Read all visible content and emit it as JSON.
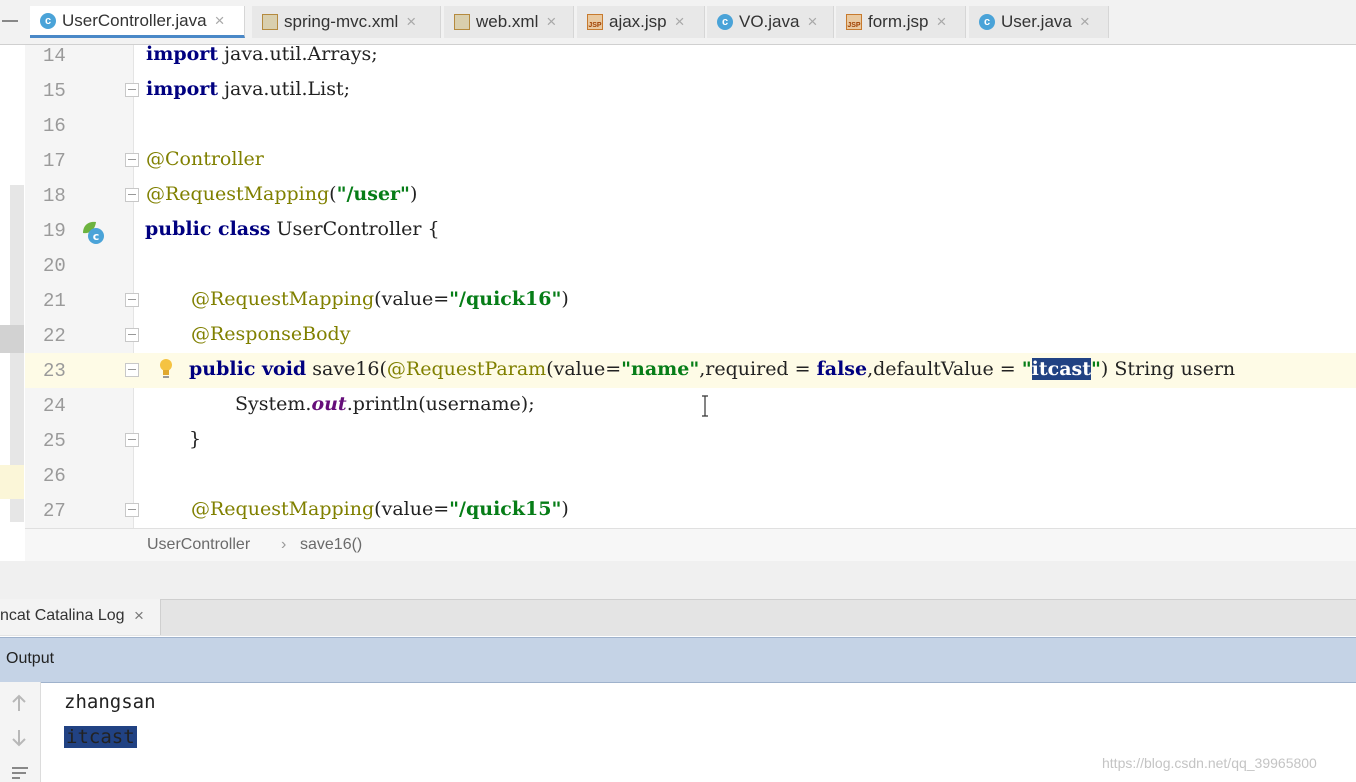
{
  "tabs": [
    {
      "label": "UserController.java",
      "icon": "java-class-icon",
      "active": true
    },
    {
      "label": "spring-mvc.xml",
      "icon": "spring-xml-icon",
      "active": false
    },
    {
      "label": "web.xml",
      "icon": "xml-file-icon",
      "active": false
    },
    {
      "label": "ajax.jsp",
      "icon": "jsp-file-icon",
      "active": false
    },
    {
      "label": "VO.java",
      "icon": "java-class-icon",
      "active": false
    },
    {
      "label": "form.jsp",
      "icon": "jsp-file-icon",
      "active": false
    },
    {
      "label": "User.java",
      "icon": "java-class-icon",
      "active": false
    }
  ],
  "editor": {
    "line_numbers": [
      "14",
      "15",
      "16",
      "17",
      "18",
      "19",
      "20",
      "21",
      "22",
      "23",
      "24",
      "25",
      "26",
      "27"
    ],
    "code": {
      "l14_kw": "import",
      "l14_rest": " java.util.Arrays;",
      "l15_kw": "import",
      "l15_rest": " java.util.List;",
      "l17_ann": "@Controller",
      "l18_ann": "@RequestMapping",
      "l18_p1": "(",
      "l18_str": "\"/user\"",
      "l18_p2": ")",
      "l19_kw": "public class",
      "l19_rest": " UserController {",
      "l21_ann": "@RequestMapping",
      "l21_p1": "(value=",
      "l21_str": "\"/quick16\"",
      "l21_p2": ")",
      "l22_ann": "@ResponseBody",
      "l23_kw1": "public void",
      "l23_p1": " save16(",
      "l23_ann": "@RequestParam",
      "l23_p2": "(value=",
      "l23_str1": "\"name\"",
      "l23_p3": ",required = ",
      "l23_kw2": "false",
      "l23_p4": ",defaultValue = ",
      "l23_q1": "\"",
      "l23_sel": "itcast",
      "l23_q2": "\"",
      "l23_p5": ") String usern",
      "l24_p1": "System.",
      "l24_stat": "out",
      "l24_p2": ".println(username);",
      "l25": "}",
      "l27_ann": "@RequestMapping",
      "l27_p1": "(value=",
      "l27_str": "\"/quick15\"",
      "l27_p2": ")"
    }
  },
  "breadcrumb": {
    "class": "UserController",
    "sep": "›",
    "method": "save16()"
  },
  "tool_window": {
    "log_tab": "ncat Catalina Log",
    "output_label": "Output"
  },
  "output": {
    "lines": [
      "zhangsan",
      "itcast"
    ]
  },
  "watermark": "https://blog.csdn.net/qq_39965800",
  "colors": {
    "keyword": "#000080",
    "annotation": "#808000",
    "string": "#067d17",
    "selection": "#214283",
    "output_header": "#c5d3e6"
  }
}
